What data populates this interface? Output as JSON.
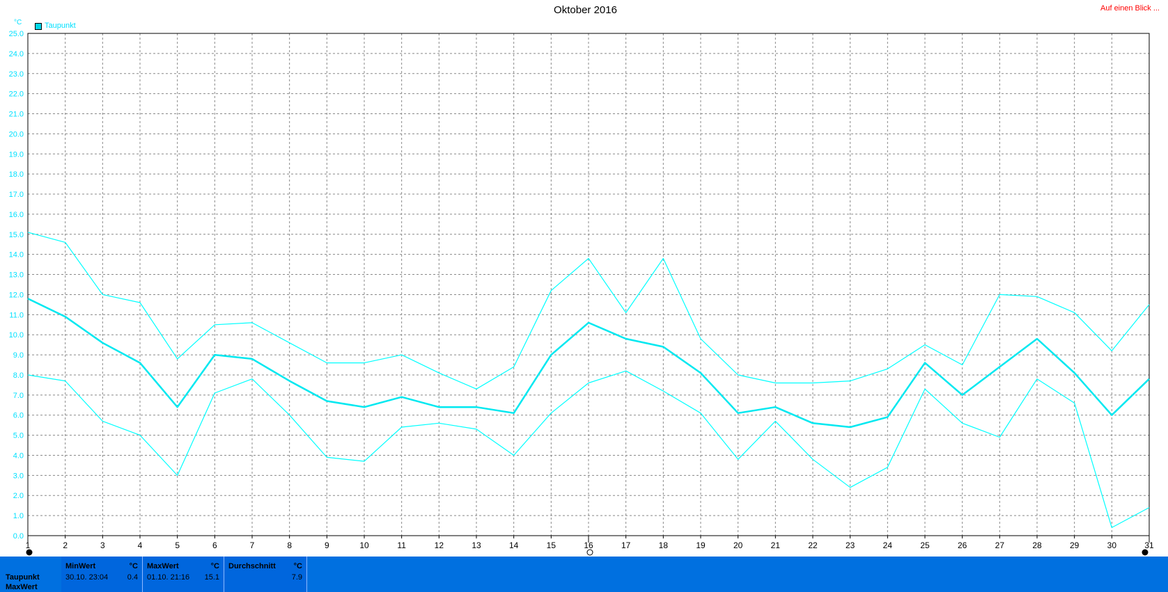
{
  "title": "Oktober 2016",
  "link_label": "Auf einen Blick ...",
  "y_unit": "°C",
  "legend_label": "Taupunkt",
  "colors": {
    "series": "#00ffff",
    "series_bold": "#00e8f0",
    "axis_text": "#00e0ff",
    "panel": "#0070e0",
    "link": "#ff0000"
  },
  "chart_data": {
    "type": "line",
    "title": "Oktober 2016",
    "ylabel": "°C",
    "xlabel": "",
    "ylim": [
      0,
      25
    ],
    "xlim": [
      1,
      31
    ],
    "grid": true,
    "legend_position": "top-left",
    "y_ticks": [
      "0.0",
      "1.0",
      "2.0",
      "3.0",
      "4.0",
      "5.0",
      "6.0",
      "7.0",
      "8.0",
      "9.0",
      "10.0",
      "11.0",
      "12.0",
      "13.0",
      "14.0",
      "15.0",
      "16.0",
      "17.0",
      "18.0",
      "19.0",
      "20.0",
      "21.0",
      "22.0",
      "23.0",
      "24.0",
      "25.0"
    ],
    "x": [
      1,
      2,
      3,
      4,
      5,
      6,
      7,
      8,
      9,
      10,
      11,
      12,
      13,
      14,
      15,
      16,
      17,
      18,
      19,
      20,
      21,
      22,
      23,
      24,
      25,
      26,
      27,
      28,
      29,
      30,
      31
    ],
    "series": [
      {
        "name": "Taupunkt",
        "role": "max",
        "values": [
          15.1,
          14.6,
          12.0,
          11.6,
          8.8,
          10.5,
          10.6,
          9.6,
          8.6,
          8.6,
          9.0,
          8.1,
          7.3,
          8.4,
          12.2,
          13.8,
          11.1,
          13.8,
          9.8,
          8.0,
          7.6,
          7.6,
          7.7,
          8.3,
          9.5,
          8.5,
          12.0,
          11.9,
          11.1,
          9.2,
          11.5
        ]
      },
      {
        "name": "Taupunkt",
        "role": "avg",
        "values": [
          11.8,
          10.9,
          9.6,
          8.6,
          6.4,
          9.0,
          8.8,
          7.7,
          6.7,
          6.4,
          6.9,
          6.4,
          6.4,
          6.1,
          9.0,
          10.6,
          9.8,
          9.4,
          8.1,
          6.1,
          6.4,
          5.6,
          5.4,
          5.9,
          8.6,
          7.0,
          8.4,
          9.8,
          8.1,
          6.0,
          7.8
        ]
      },
      {
        "name": "Taupunkt",
        "role": "min",
        "values": [
          8.0,
          7.7,
          5.7,
          5.0,
          3.0,
          7.1,
          7.8,
          6.0,
          3.9,
          3.7,
          5.4,
          5.6,
          5.3,
          4.0,
          6.1,
          7.6,
          8.2,
          7.2,
          6.1,
          3.8,
          5.7,
          3.8,
          2.4,
          3.4,
          7.3,
          5.6,
          4.9,
          7.8,
          6.6,
          0.4,
          1.4
        ]
      }
    ]
  },
  "stats": {
    "row_label_1": "Taupunkt",
    "row_label_2": "MaxWert",
    "min_header": "MinWert",
    "min_unit": "°C",
    "min_time": "30.10.  23:04",
    "min_value": "0.4",
    "max_header": "MaxWert",
    "max_unit": "°C",
    "max_time": "01.10.  21:16",
    "max_value": "15.1",
    "avg_header": "Durchschnitt",
    "avg_unit": "°C",
    "avg_value": "7.9"
  }
}
